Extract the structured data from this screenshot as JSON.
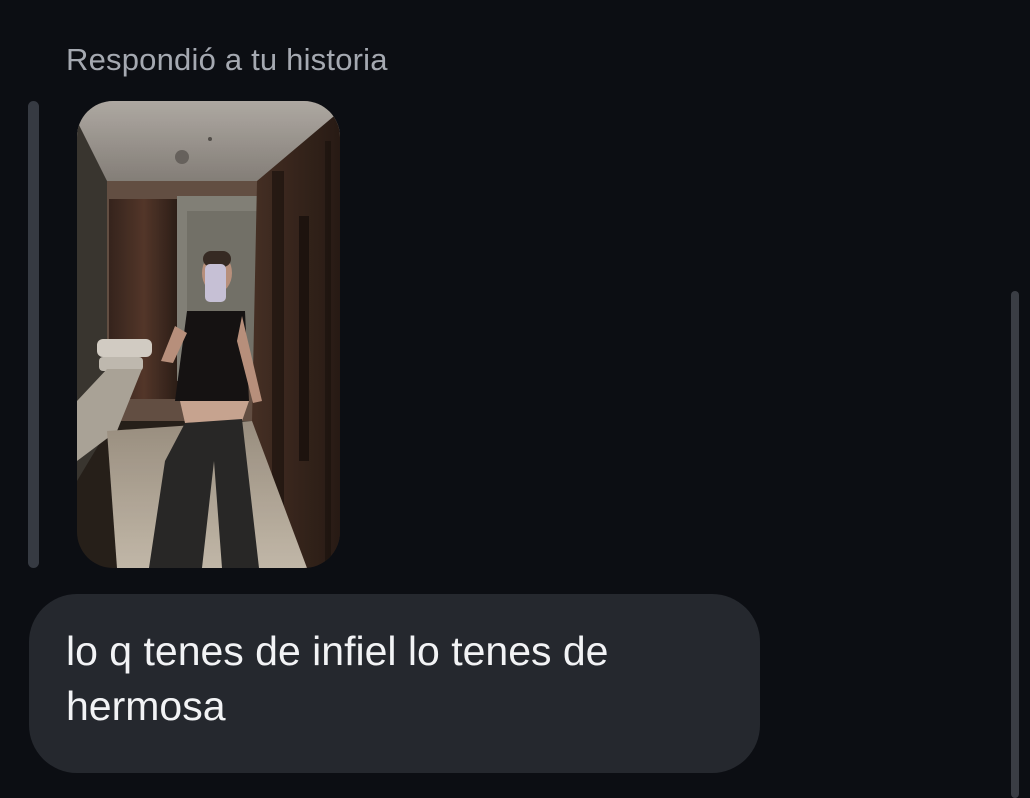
{
  "story_reply": {
    "caption": "Respondió a tu historia",
    "thumbnail_icon": "story-photo"
  },
  "message": {
    "text": "lo q tenes de infiel lo tenes de hermosa"
  },
  "colors": {
    "background": "#0c0e13",
    "bubble": "#25282e",
    "caption_text": "#a5a9b1",
    "message_text": "#f2f3f5",
    "quote_bar": "#363a42"
  }
}
